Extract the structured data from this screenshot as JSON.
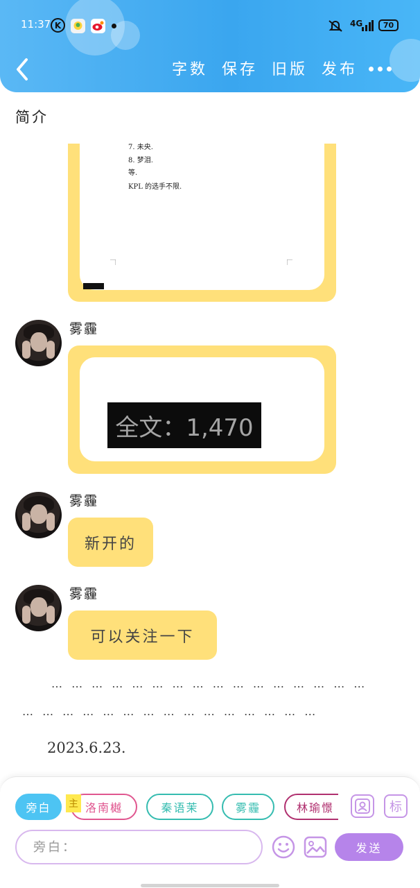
{
  "status_bar": {
    "time": "11:37",
    "k_badge": "K",
    "network": "4G",
    "battery": "70"
  },
  "header": {
    "actions": [
      "字数",
      "保存",
      "旧版",
      "发布"
    ]
  },
  "intro_label": "简介",
  "doc_preview": {
    "lines": [
      "7.  未央.",
      "8.  梦泪.",
      "等.",
      "KPL 的选手不限."
    ]
  },
  "messages": [
    {
      "sender": "雾霾",
      "type": "image",
      "overlay_text": "全文：1,470"
    },
    {
      "sender": "雾霾",
      "type": "text",
      "text": "新开的"
    },
    {
      "sender": "雾霾",
      "type": "text",
      "text": "可以关注一下"
    }
  ],
  "ellipsis_lines": [
    "… … … … … … … … … … … … … … … …",
    "… … … … … … … … … … … … … … …"
  ],
  "date": "2023.6.23.",
  "composer": {
    "characters": [
      {
        "label": "旁白",
        "style": "filled",
        "color": "#4dc4f3"
      },
      {
        "label": "洛南樾",
        "style": "outline",
        "color": "#e0568f"
      },
      {
        "label": "秦语茉",
        "style": "outline",
        "color": "#35bcb0"
      },
      {
        "label": "雾霾",
        "style": "outline",
        "color": "#35bcb0"
      },
      {
        "label": "林瑜憬",
        "style": "outline",
        "color": "#b0306f"
      }
    ],
    "active_tag": "主",
    "tool_tag_label": "标",
    "input_placeholder": "旁白：",
    "send_label": "发送"
  },
  "colors": {
    "header_blue": "#3aa6ef",
    "bubble_yellow": "#ffe07a",
    "accent_purple": "#b684ea"
  }
}
